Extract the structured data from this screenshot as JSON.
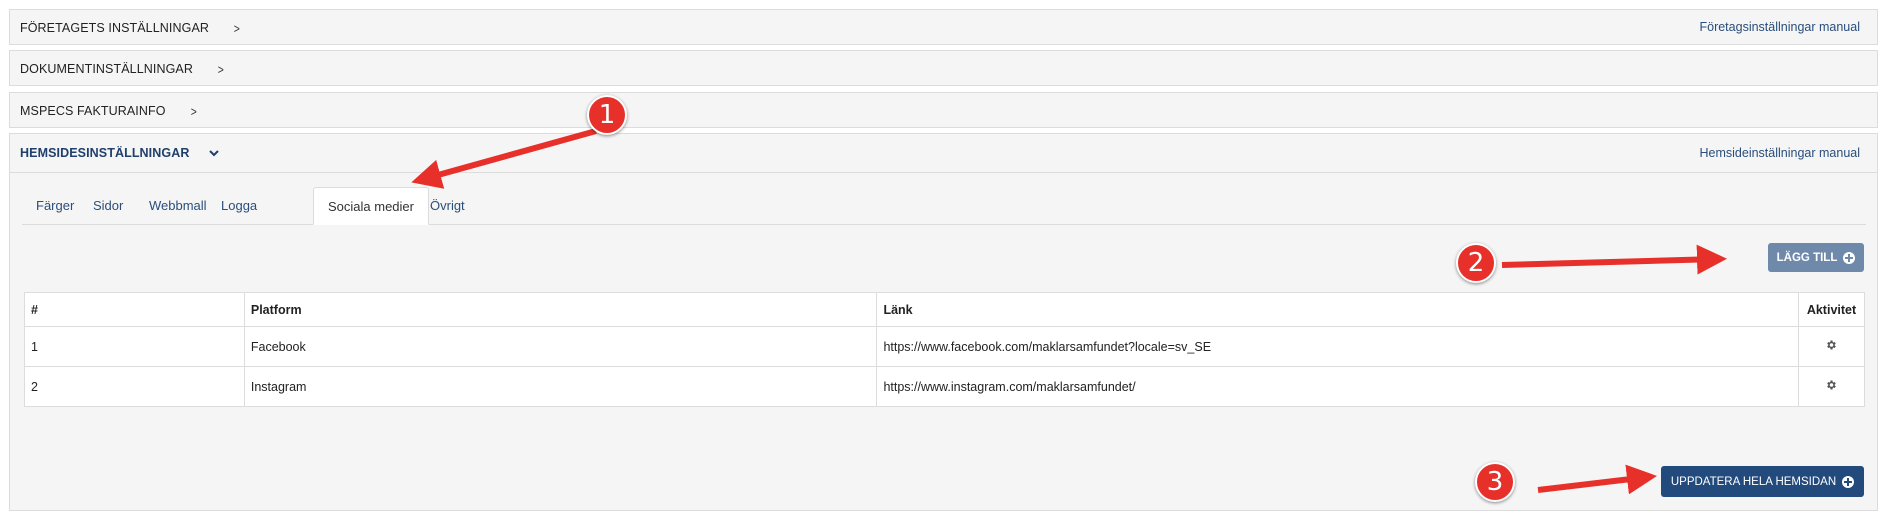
{
  "sections": [
    {
      "title": "FÖRETAGETS INSTÄLLNINGAR",
      "manual_link": "Företagsinställningar manual"
    },
    {
      "title": "DOKUMENTINSTÄLLNINGAR"
    },
    {
      "title": "MSPECS FAKTURAINFO"
    },
    {
      "title": "HEMSIDESINSTÄLLNINGAR",
      "manual_link": "Hemsideinställningar manual"
    }
  ],
  "tabs": [
    "Färger",
    "Sidor",
    "Webbmall",
    "Logga",
    "Sociala medier",
    "Övrigt"
  ],
  "active_tab": "Sociala medier",
  "add_button": "LÄGG TILL",
  "table": {
    "headers": [
      "#",
      "Platform",
      "Länk",
      "Aktivitet"
    ],
    "rows": [
      {
        "num": "1",
        "platform": "Facebook",
        "link": "https://www.facebook.com/maklarsamfundet?locale=sv_SE",
        "action_icon": "gear-icon"
      },
      {
        "num": "2",
        "platform": "Instagram",
        "link": "https://www.instagram.com/maklarsamfundet/",
        "action_icon": "gear-icon"
      }
    ]
  },
  "update_button": "UPPDATERA HELA HEMSIDAN",
  "callouts": [
    "1",
    "2",
    "3"
  ],
  "colors": {
    "accent_dark": "#234a7c",
    "accent_muted": "#6f89ab",
    "link": "#2a4e7c",
    "callout_red": "#e8302a"
  }
}
